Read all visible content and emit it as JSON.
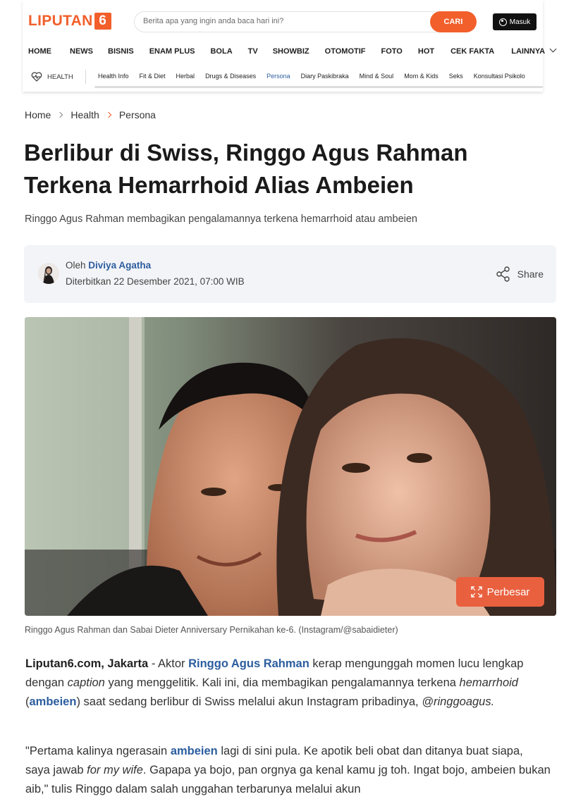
{
  "header": {
    "logo_text": "LIPUTAN",
    "logo_number": "6",
    "search_placeholder": "Berita apa yang ingin anda baca hari ini?",
    "search_button": "CARI",
    "login_button": "Masuk"
  },
  "mainnav": {
    "items": [
      "HOME",
      "NEWS",
      "BISNIS",
      "ENAM PLUS",
      "BOLA",
      "TV",
      "SHOWBIZ",
      "OTOMOTIF",
      "FOTO",
      "HOT",
      "CEK FAKTA",
      "LAINNYA"
    ]
  },
  "subnav": {
    "section": "HEALTH",
    "items": [
      "Health Info",
      "Fit & Diet",
      "Herbal",
      "Drugs & Diseases",
      "Persona",
      "Diary Paskibraka",
      "Mind & Soul",
      "Mom & Kids",
      "Seks",
      "Konsultasi Psikolo"
    ],
    "active": "Persona"
  },
  "breadcrumb": [
    "Home",
    "Health",
    "Persona"
  ],
  "article": {
    "title_line1": "Berlibur di Swiss, Ringgo Agus Rahman",
    "title_line2": "Terkena Hemarrhoid Alias Ambeien",
    "lead": "Ringgo Agus Rahman membagikan pengalamannya terkena hemarrhoid atau ambeien",
    "by_prefix": "Oleh",
    "author": "Diviya Agatha",
    "published": "Diterbitkan 22 Desember 2021, 07:00 WIB",
    "share_label": "Share",
    "enlarge_label": "Perbesar",
    "caption": "Ringgo Agus Rahman dan Sabai Dieter Anniversary Pernikahan ke-6. (Instagram/@sabaidieter)",
    "p1": {
      "source": "Liputan6.com, Jakarta",
      "t1": " - Aktor ",
      "link1": "Ringgo Agus Rahman",
      "t2": " kerap mengunggah momen lucu lengkap dengan ",
      "i1": "caption",
      "t3": " yang menggelitik. Kali ini, dia membagikan pengalamannya terkena ",
      "i2": "hemarrhoid",
      "t4": " (",
      "link2": "ambeien",
      "t5": ") saat sedang berlibur di Swiss melalui akun Instagram pribadinya, ",
      "i3": "@ringgoagus."
    },
    "p2": {
      "t1": "\"Pertama kalinya ngerasain ",
      "link1": "ambeien",
      "t2": " lagi di sini pula. Ke apotik beli obat dan ditanya buat siapa, saya jawab ",
      "i1": "for my wife",
      "t3": ". Gapapa ya bojo, pan orgnya ga kenal kamu jg toh. Ingat bojo, ambeien bukan aib,\" tulis Ringgo dalam salah unggahan terbarunya melalui akun"
    }
  },
  "colors": {
    "brand": "#f25f2b",
    "link": "#2c5d9e",
    "login_bg": "#111111",
    "card_bg": "#f3f4f8"
  },
  "icons": [
    "user-icon",
    "chevron-down-icon",
    "heart-pulse-icon",
    "chevron-right-icon",
    "share-icon",
    "expand-icon"
  ]
}
